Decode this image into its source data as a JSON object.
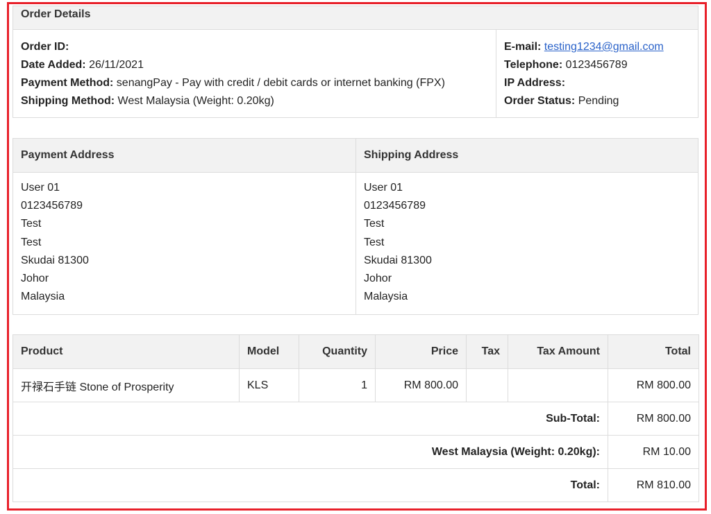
{
  "order_details": {
    "heading": "Order Details",
    "left": [
      {
        "label": "Order ID:",
        "value": ""
      },
      {
        "label": "Date Added:",
        "value": " 26/11/2021"
      },
      {
        "label": "Payment Method:",
        "value": " senangPay - Pay with credit / debit cards or internet banking (FPX)"
      },
      {
        "label": "Shipping Method:",
        "value": " West Malaysia (Weight: 0.20kg)"
      }
    ],
    "right": {
      "email_label": "E-mail:",
      "email_value": "testing1234@gmail.com",
      "telephone_label": "Telephone:",
      "telephone_value": " 0123456789",
      "ip_label": "IP Address:",
      "ip_value": "",
      "status_label": "Order Status:",
      "status_value": " Pending"
    }
  },
  "payment_address": {
    "heading": "Payment Address",
    "lines": [
      "User 01",
      "0123456789",
      "Test",
      "Test",
      "Skudai 81300",
      "Johor",
      "Malaysia"
    ]
  },
  "shipping_address": {
    "heading": "Shipping Address",
    "lines": [
      "User 01",
      "0123456789",
      "Test",
      "Test",
      "Skudai 81300",
      "Johor",
      "Malaysia"
    ]
  },
  "products": {
    "columns": [
      "Product",
      "Model",
      "Quantity",
      "Price",
      "Tax",
      "Tax Amount",
      "Total"
    ],
    "rows": [
      {
        "product": "开禄石手链 Stone of Prosperity",
        "model": "KLS",
        "quantity": "1",
        "price": "RM 800.00",
        "tax": "",
        "tax_amount": "",
        "total": "RM 800.00"
      }
    ],
    "totals": [
      {
        "label": "Sub-Total:",
        "value": "RM 800.00"
      },
      {
        "label": "West Malaysia (Weight: 0.20kg):",
        "value": "RM 10.00"
      },
      {
        "label": "Total:",
        "value": "RM 810.00"
      }
    ]
  },
  "colors": {
    "frame": "#e8202a",
    "header_bg": "#f2f2f2",
    "border": "#dcdcdc",
    "link": "#2a62c9"
  }
}
